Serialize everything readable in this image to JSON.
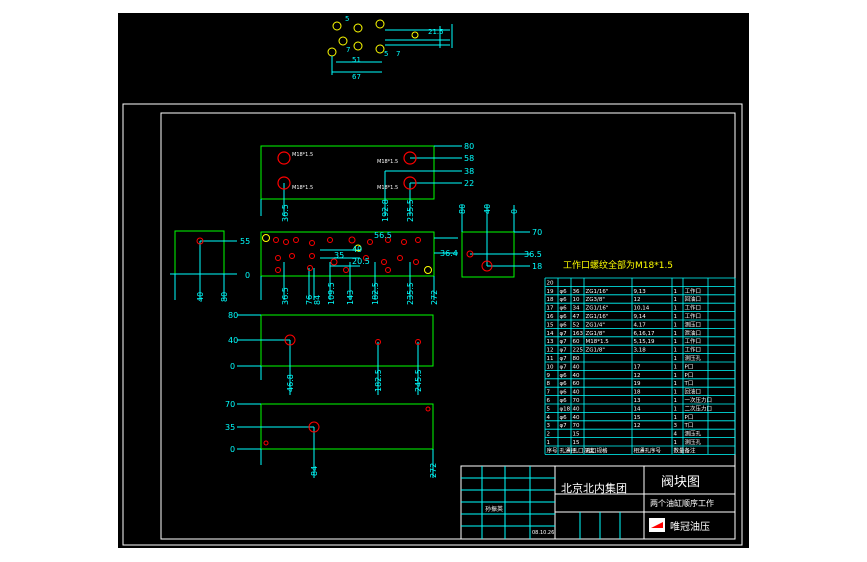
{
  "colors": {
    "background": "#000000",
    "border": "#ffffff",
    "part_outline": "#00ff00",
    "dimension": "#00ffff",
    "port": "#ff0000",
    "highlight": "#ffff00",
    "text": "#ffffff"
  },
  "detail": {
    "labels": [
      "5",
      "7",
      "5",
      "21.5",
      "7",
      "51",
      "67"
    ]
  },
  "top_view": {
    "thread_labels": [
      "M18*1.5",
      "M18*1.5",
      "M18*1.5",
      "M18*1.5"
    ],
    "right_dims": [
      "80",
      "58",
      "38",
      "22"
    ],
    "bottom_dims": [
      "36.5",
      "192.8",
      "235.5"
    ]
  },
  "front_view": {
    "right_dims": [
      "56.5",
      "36.4"
    ],
    "bottom_dims": [
      "36.5",
      "76",
      "84",
      "109.5",
      "143",
      "182.5",
      "235.5",
      "272"
    ],
    "inner_labels": [
      "49",
      "35",
      "20.5"
    ]
  },
  "left_view": {
    "dims": [
      "55",
      "0",
      "40",
      "80"
    ]
  },
  "right_view": {
    "top_dims": [
      "80",
      "40",
      "0"
    ],
    "right_dims": [
      "70",
      "36.5",
      "18"
    ]
  },
  "lower_view_a": {
    "left_dims": [
      "80",
      "40",
      "0"
    ],
    "bottom_dims": [
      "46.8",
      "182.5",
      "245.5"
    ]
  },
  "lower_view_b": {
    "left_dims": [
      "70",
      "35",
      "0"
    ],
    "bottom_dims": [
      "84",
      "272"
    ]
  },
  "note": "工作口螺纹全部为M18*1.5",
  "table": {
    "rows": [
      [
        "20",
        "",
        "",
        "",
        "",
        "",
        ""
      ],
      [
        "19",
        "φ6",
        "36",
        "ZG1/16\"",
        "9,13",
        "1",
        "工作口"
      ],
      [
        "18",
        "φ6",
        "10",
        "ZG3/8\"",
        "12",
        "1",
        "回油口"
      ],
      [
        "17",
        "φ6",
        "34",
        "ZG1/16\"",
        "10,14",
        "1",
        "工作口"
      ],
      [
        "16",
        "φ6",
        "47",
        "ZG1/16\"",
        "9,14",
        "1",
        "工作口"
      ],
      [
        "15",
        "φ6",
        "52",
        "ZG1/4\"",
        "4,17",
        "1",
        "测压口"
      ],
      [
        "14",
        "φ7",
        "163",
        "ZG1/8\"",
        "6,16,17",
        "1",
        "泄油口"
      ],
      [
        "13",
        "φ7",
        "60",
        "M18*1.5",
        "5,15,19",
        "1",
        "工作口"
      ],
      [
        "12",
        "φ7",
        "225",
        "ZG1/8\"",
        "3,18",
        "1",
        "工作口"
      ],
      [
        "11",
        "φ7",
        "80",
        "",
        "",
        "1",
        "测压孔"
      ],
      [
        "10",
        "φ7",
        "40",
        "",
        "17",
        "1",
        "P口"
      ],
      [
        "9",
        "φ6",
        "40",
        "",
        "12",
        "1",
        "P口"
      ],
      [
        "8",
        "φ6",
        "60",
        "",
        "19",
        "1",
        "T口"
      ],
      [
        "7",
        "φ6",
        "40",
        "",
        "18",
        "1",
        "回油口"
      ],
      [
        "6",
        "φ6",
        "70",
        "",
        "13",
        "1",
        "一次压力口"
      ],
      [
        "5",
        "φ18",
        "40",
        "",
        "14",
        "1",
        "二次压力口"
      ],
      [
        "4",
        "φ6",
        "40",
        "",
        "15",
        "1",
        "P口"
      ],
      [
        "3",
        "φ7",
        "70",
        "",
        "12",
        "3",
        "T口"
      ],
      [
        "2",
        "",
        "15",
        "",
        "",
        "4",
        "测压孔"
      ],
      [
        "1",
        "",
        "15",
        "",
        "",
        "1",
        "测压孔"
      ]
    ],
    "header": [
      "序号",
      "孔通径",
      "孔口深度",
      "孔口规格",
      "相通孔序号",
      "数量",
      "备注"
    ]
  },
  "title_block": {
    "company": "北京北内集团",
    "drawing_title": "阀块图",
    "subtitle": "两个油缸顺序工作",
    "logo_text": "唯冠油压",
    "designer": "孙振英",
    "date": "08.10.26"
  }
}
